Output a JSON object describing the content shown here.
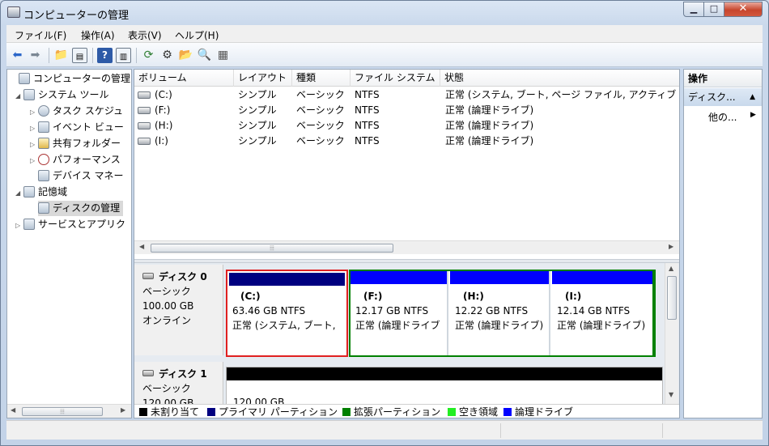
{
  "window": {
    "title": "コンピューターの管理"
  },
  "menu": [
    "ファイル(F)",
    "操作(A)",
    "表示(V)",
    "ヘルプ(H)"
  ],
  "toolbar": {
    "buttons": [
      "back-arrow-icon",
      "forward-arrow-icon",
      "up-folder-icon",
      "show-hide-tree-icon",
      "help-icon",
      "properties-icon",
      "refresh-icon",
      "settings-icon",
      "open-folder-icon",
      "search-icon",
      "export-icon"
    ]
  },
  "tree": [
    {
      "label": "コンピューターの管理",
      "expander": "",
      "icon": "computer-management-icon"
    },
    {
      "label": "システム ツール",
      "expander": "◢",
      "icon": "tools-icon"
    },
    {
      "label": "タスク スケジュ",
      "expander": "▷",
      "icon": "clock-icon"
    },
    {
      "label": "イベント ビュー",
      "expander": "▷",
      "icon": "event-viewer-icon"
    },
    {
      "label": "共有フォルダー",
      "expander": "▷",
      "icon": "shared-folder-icon"
    },
    {
      "label": "パフォーマンス",
      "expander": "▷",
      "icon": "performance-icon"
    },
    {
      "label": "デバイス マネー",
      "expander": "",
      "icon": "device-manager-icon"
    },
    {
      "label": "記憶域",
      "expander": "◢",
      "icon": "storage-icon"
    },
    {
      "label": "ディスクの管理",
      "expander": "",
      "icon": "disk-management-icon"
    },
    {
      "label": "サービスとアプリク",
      "expander": "▷",
      "icon": "services-icon"
    }
  ],
  "volume_list": {
    "columns": [
      "ボリューム",
      "レイアウト",
      "種類",
      "ファイル システム",
      "状態"
    ],
    "rows": [
      [
        "(C:)",
        "シンプル",
        "ベーシック",
        "NTFS",
        "正常 (システム, ブート, ページ ファイル, アクティブ"
      ],
      [
        "(F:)",
        "シンプル",
        "ベーシック",
        "NTFS",
        "正常 (論理ドライブ)"
      ],
      [
        "(H:)",
        "シンプル",
        "ベーシック",
        "NTFS",
        "正常 (論理ドライブ)"
      ],
      [
        "(I:)",
        "シンプル",
        "ベーシック",
        "NTFS",
        "正常 (論理ドライブ)"
      ]
    ]
  },
  "disks": [
    {
      "name": "ディスク 0",
      "type": "ベーシック",
      "size": "100.00 GB",
      "status": "オンライン",
      "partitions": [
        {
          "title": "(C:)",
          "size": "63.46 GB NTFS",
          "status": "正常 (システム, ブート,",
          "bar_color": "#000080",
          "selected": true
        },
        {
          "title": "(F:)",
          "size": "12.17 GB NTFS",
          "status": "正常 (論理ドライブ",
          "bar_color": "#0000ff"
        },
        {
          "title": "(H:)",
          "size": "12.22 GB NTFS",
          "status": "正常 (論理ドライブ)",
          "bar_color": "#0000ff"
        },
        {
          "title": "(I:)",
          "size": "12.14 GB NTFS",
          "status": "正常 (論理ドライブ)",
          "bar_color": "#0000ff"
        }
      ]
    },
    {
      "name": "ディスク 1",
      "type": "ベーシック",
      "size": "120.00 GB",
      "status": "",
      "unallocated_label": "120.00 GB"
    }
  ],
  "legend": [
    {
      "label": "未割り当て",
      "color": "#000000"
    },
    {
      "label": "プライマリ パーティション",
      "color": "#000080"
    },
    {
      "label": "拡張パーティション",
      "color": "#008000"
    },
    {
      "label": "空き領域",
      "color": "#22ee22"
    },
    {
      "label": "論理ドライブ",
      "color": "#0000ff"
    }
  ],
  "actions": {
    "title": "操作",
    "group": "ディスク...",
    "item": "他の..."
  }
}
